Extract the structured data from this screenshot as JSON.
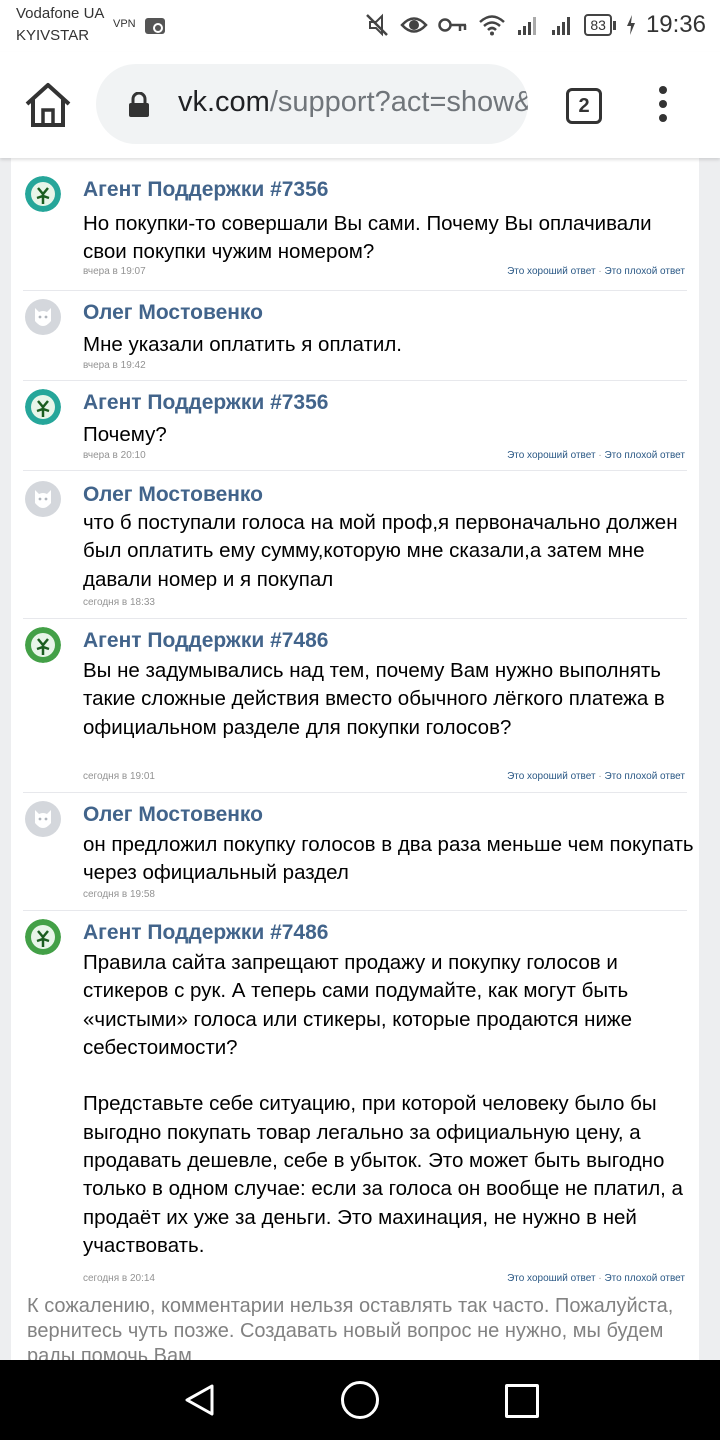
{
  "status_bar": {
    "carrier_1": "Vodafone UA",
    "carrier_2": "KYIVSTAR",
    "vpn": "VPN",
    "battery": "83",
    "time": "19:36",
    "icons": [
      "notification-muted-icon",
      "eye-icon",
      "key-icon",
      "wifi-icon",
      "signal-1-icon",
      "signal-2-icon",
      "battery-icon",
      "charging-icon"
    ]
  },
  "browser": {
    "url_host": "vk.com",
    "url_path": "/support?act=show&",
    "tab_count": "2",
    "icons": [
      "home-icon",
      "lock-icon",
      "tabs-icon",
      "more-vert-icon"
    ]
  },
  "messages": [
    {
      "author": "Агент Поддержки #7356",
      "avatar": "agent-teal",
      "text": "Но покупки-то совершали Вы сами. Почему Вы оплачивали свои покупки чужим номером?",
      "time": "вчера в 19:07",
      "rate": true
    },
    {
      "author": "Олег Мостовенко",
      "avatar": "user-default",
      "text": "Мне указали оплатить я оплатил.",
      "time": "вчера в 19:42",
      "rate": false
    },
    {
      "author": "Агент Поддержки #7356",
      "avatar": "agent-teal",
      "text": "Почему?",
      "time": "вчера в 20:10",
      "rate": true
    },
    {
      "author": "Олег Мостовенко",
      "avatar": "user-default",
      "text": "что б поступали голоса на мой проф,я первоначально должен был оплатить ему сумму,которую мне сказали,а затем мне давали номер и я покупал",
      "time": "сегодня в 18:33",
      "rate": false
    },
    {
      "author": "Агент Поддержки #7486",
      "avatar": "agent-green",
      "text": "Вы не задумывались над тем, почему Вам нужно выполнять такие сложные действия вместо обычного лёгкого платежа в официальном разделе для покупки голосов?",
      "time": "сегодня в 19:01",
      "rate": true
    },
    {
      "author": "Олег Мостовенко",
      "avatar": "user-default",
      "text": "он предложил покупку голосов в два раза меньше чем покупать через официальный раздел",
      "time": "сегодня в 19:58",
      "rate": false
    },
    {
      "author": "Агент Поддержки #7486",
      "avatar": "agent-green",
      "text": "Правила сайта запрещают продажу и покупку голосов и стикеров с рук. А теперь сами подумайте, как могут быть «чистыми» голоса или стикеры, которые продаются ниже себестоимости?\n\nПредставьте себе ситуацию, при которой человеку было бы выгодно покупать товар легально за официальную цену, а продавать дешевле, себе в убыток. Это может быть выгодно только в одном случае: если за голоса он вообще не платил, а продаёт их уже за деньги. Это махинация, не нужно в ней участвовать.",
      "time": "сегодня в 20:14",
      "rate": true
    }
  ],
  "rate_labels": {
    "good": "Это хороший ответ",
    "separator": "·",
    "bad": "Это плохой ответ"
  },
  "notice": "К сожалению, комментарии нельзя оставлять так часто. Пожалуйста, вернитесь чуть позже. Создавать новый вопрос не нужно, мы будем рады помочь Вам",
  "colors": {
    "name": "#42648b",
    "link": "#2a5885",
    "time": "#939393",
    "agent_teal": "#26a69a",
    "agent_green": "#43a047",
    "page_bg": "#edeef0"
  },
  "nav_bar": {
    "icons": [
      "back-icon",
      "home-circle-icon",
      "recents-icon"
    ]
  }
}
